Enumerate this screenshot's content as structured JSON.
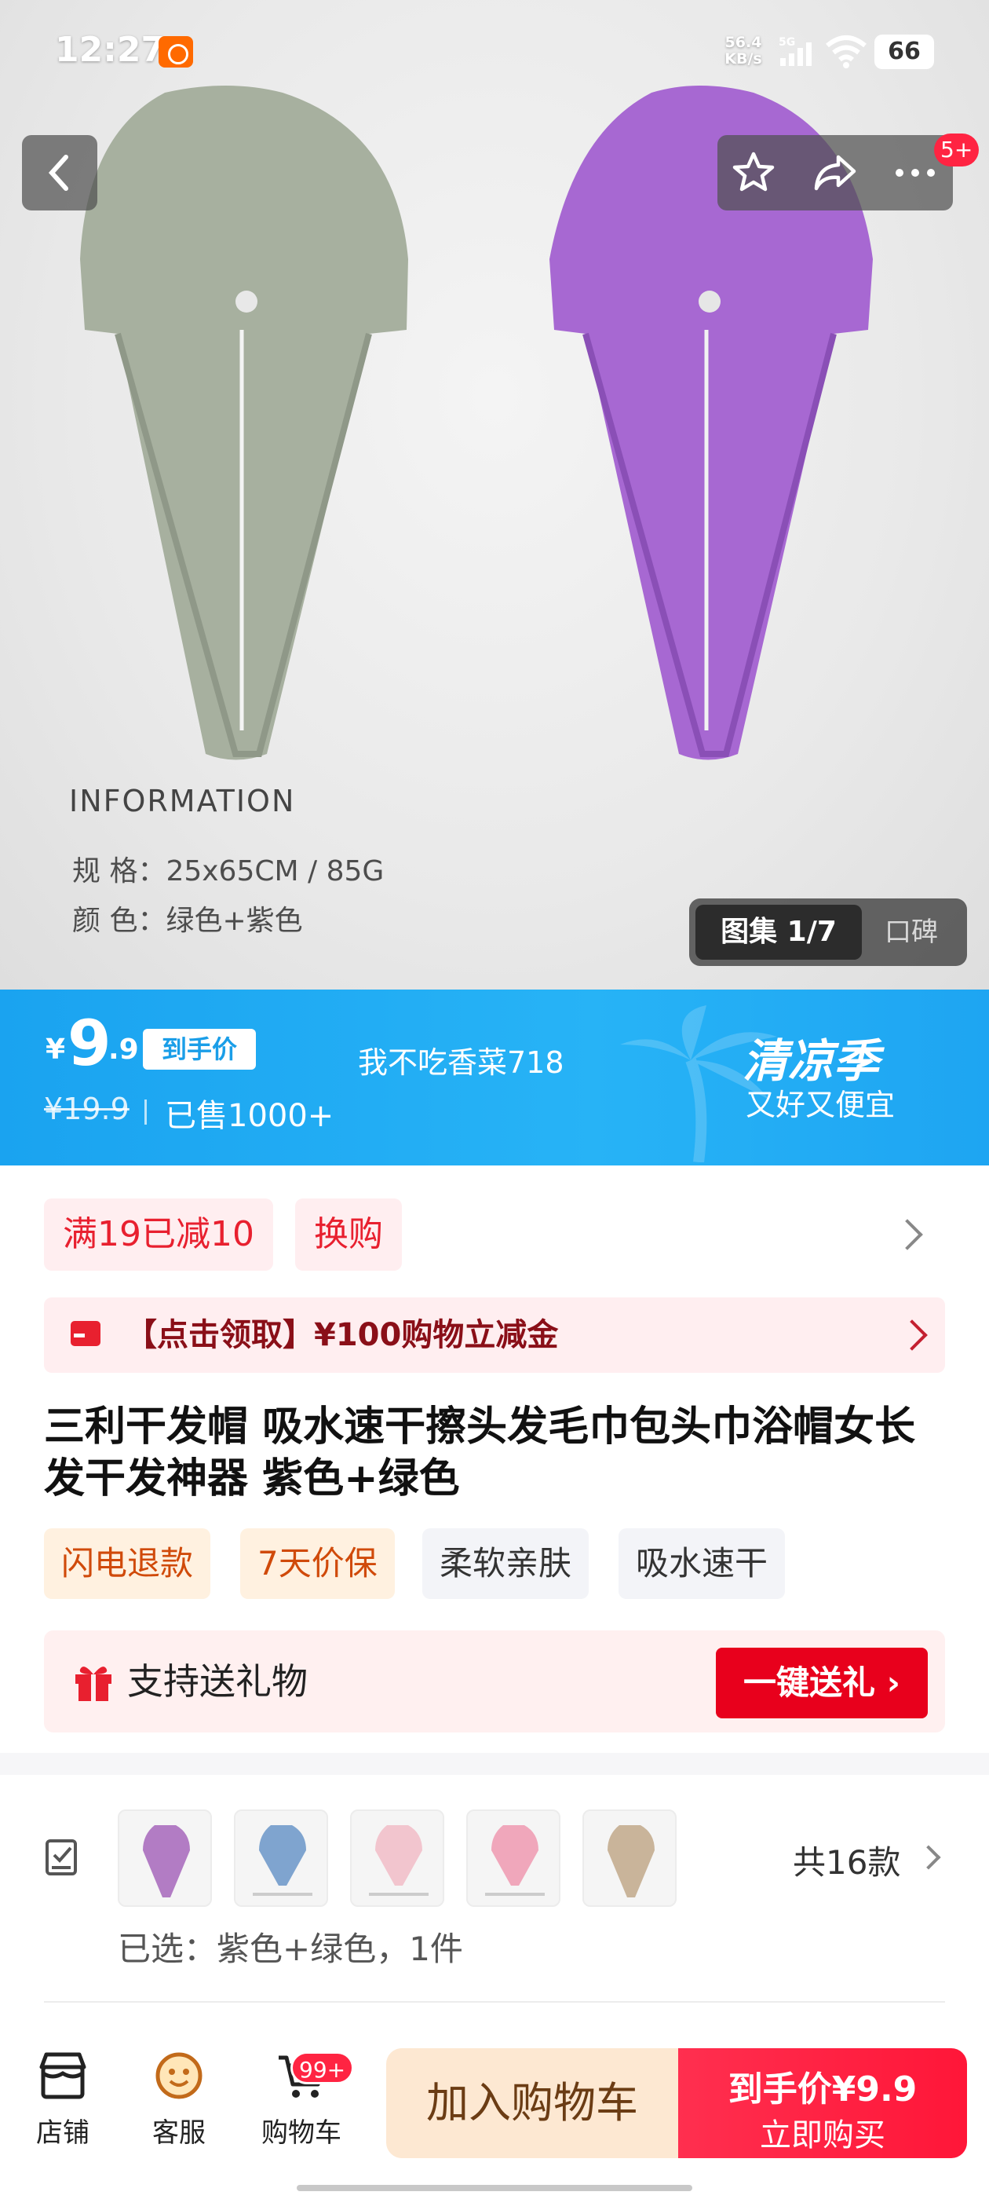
{
  "status_bar": {
    "time": "12:27",
    "net_speed_value": "56.4",
    "net_speed_unit": "KB/s",
    "network": "5G",
    "battery": "66"
  },
  "nav": {
    "badge": "5+",
    "icons": [
      "back-icon",
      "star-icon",
      "share-icon",
      "more-icon"
    ]
  },
  "hero": {
    "info_title": "INFORMATION",
    "spec_line": "规 格：25x65CM / 85G",
    "color_line": "颜 色：绿色+紫色",
    "gallery_active": "图集 1/7",
    "gallery_other": "口碑"
  },
  "price": {
    "currency": "¥",
    "integer": "9",
    "decimal": ".9",
    "tag": "到手价",
    "shop": "我不吃香菜718",
    "original": "¥19.9",
    "sold": "已售1000+",
    "season_title": "清凉季",
    "season_sub": "又好又便宜"
  },
  "promos": {
    "chip1": "满19已减10",
    "chip2": "换购",
    "coupon": "【点击领取】¥100购物立减金"
  },
  "product": {
    "title": "三利干发帽 吸水速干擦头发毛巾包头巾浴帽女长发干发神器 紫色+绿色",
    "services": [
      "闪电退款",
      "7天价保",
      "柔软亲肤",
      "吸水速干"
    ]
  },
  "gift": {
    "label": "支持送礼物",
    "button": "一键送礼 ›"
  },
  "sku": {
    "count": "共16款",
    "selected": "已选：紫色+绿色，1件",
    "thumb_colors": [
      "#b27cc4",
      "#7fa4cf",
      "#f2c5ce",
      "#f0a7bb",
      "#c9b49a"
    ]
  },
  "bottom_bar": {
    "store": "店铺",
    "service": "客服",
    "cart": "购物车",
    "cart_badge": "99+",
    "add_cart": "加入购物车",
    "buy_price": "到手价¥9.9",
    "buy_now": "立即购买"
  },
  "colors": {
    "banner_blue": "#1ea5f2",
    "accent_red": "#e8202f",
    "towel_green": "#a4ae9c",
    "towel_purple": "#a56bd4"
  }
}
